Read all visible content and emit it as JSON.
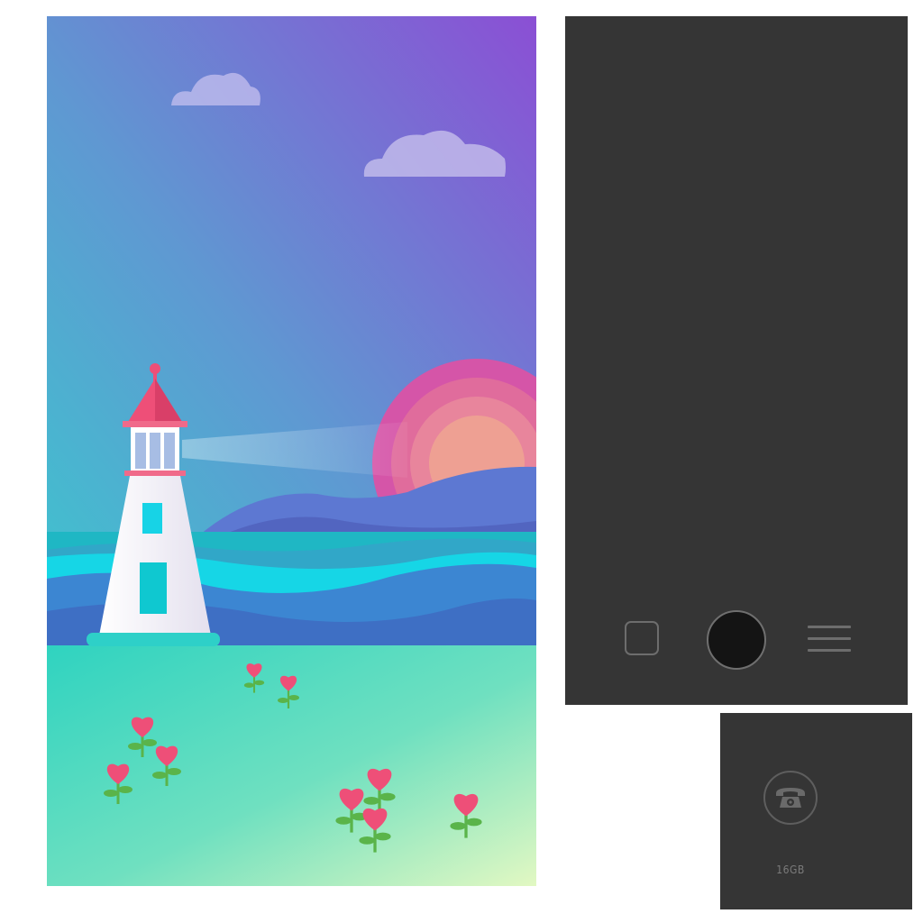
{
  "wallpaper": {
    "name": "lighthouse-wallpaper",
    "colors": {
      "sky_top": "#8b4fd4",
      "sky_bottom": "#3fc6cf",
      "sun": "#e75a9c",
      "lighthouse_roof": "#ee4f78",
      "ground_top": "#2fd3c0",
      "ground_bottom": "#dff7c4"
    }
  },
  "nav": {
    "icons": [
      "square-icon",
      "home-circle-icon",
      "menu-icon"
    ]
  },
  "storage_tile": {
    "icon": "telephone-icon",
    "label": "16GB"
  }
}
